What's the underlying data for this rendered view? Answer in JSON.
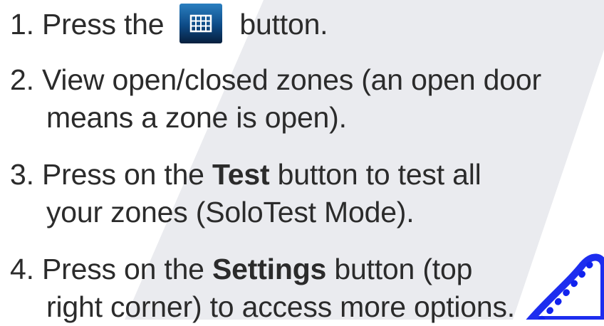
{
  "steps": [
    {
      "number": "1.",
      "before": "Press the",
      "after": "button.",
      "icon": "grid-button-icon"
    },
    {
      "number": "2.",
      "line1": "View open/closed zones (an open door",
      "line2": "means a zone is open)."
    },
    {
      "number": "3.",
      "line1_before": "Press on the",
      "line1_bold": "Test",
      "line1_after": "button to test all",
      "line2": "your zones (SoloTest Mode)."
    },
    {
      "number": "4.",
      "line1_before": "Press on the",
      "line1_bold": "Settings",
      "line1_after": "button (top",
      "line2": "right corner) to access more options."
    }
  ],
  "colors": {
    "text": "#2b2b2b",
    "background_band": "#e9eaee",
    "icon_blue": "#1e90c8",
    "icon_dark": "#0a2f55",
    "watermark": "#1122ee"
  }
}
